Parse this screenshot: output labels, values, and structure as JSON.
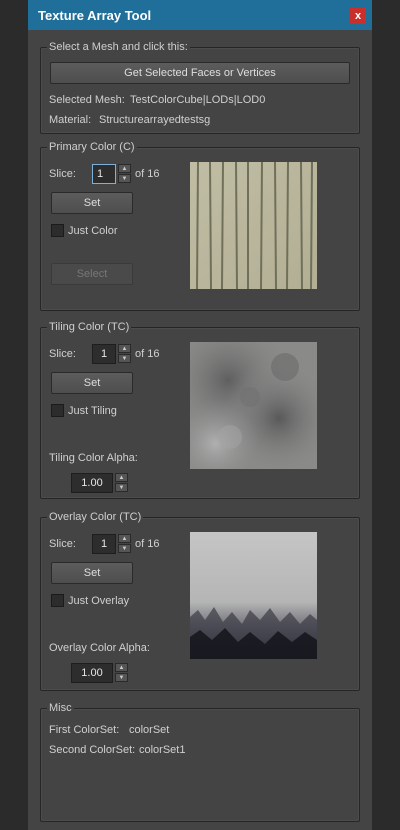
{
  "window": {
    "title": "Texture Array Tool",
    "close_label": "x"
  },
  "mesh_group": {
    "legend": "Select a Mesh and click this:",
    "get_button": "Get Selected Faces or Vertices",
    "selected_mesh_label": "Selected Mesh:",
    "selected_mesh_value": "TestColorCube|LODs|LOD0",
    "material_label": "Material:",
    "material_value": "Structurearrayedtestsg"
  },
  "primary": {
    "legend": "Primary Color (C)",
    "slice_label": "Slice:",
    "slice_value": "1",
    "of_label": "of 16",
    "set_button": "Set",
    "just_label": "Just Color",
    "select_button": "Select"
  },
  "tiling": {
    "legend": "Tiling Color (TC)",
    "slice_label": "Slice:",
    "slice_value": "1",
    "of_label": "of 16",
    "set_button": "Set",
    "just_label": "Just Tiling",
    "alpha_label": "Tiling Color Alpha:",
    "alpha_value": "1.00"
  },
  "overlay": {
    "legend": "Overlay Color (TC)",
    "slice_label": "Slice:",
    "slice_value": "1",
    "of_label": "of 16",
    "set_button": "Set",
    "just_label": "Just Overlay",
    "alpha_label": "Overlay Color Alpha:",
    "alpha_value": "1.00"
  },
  "misc": {
    "legend": "Misc",
    "first_label": "First ColorSet:",
    "first_value": "colorSet",
    "second_label": "Second ColorSet:",
    "second_value": "colorSet1"
  },
  "colors": {
    "titlebar": "#1f6f9a",
    "panel": "#444444",
    "close": "#c9302c"
  }
}
